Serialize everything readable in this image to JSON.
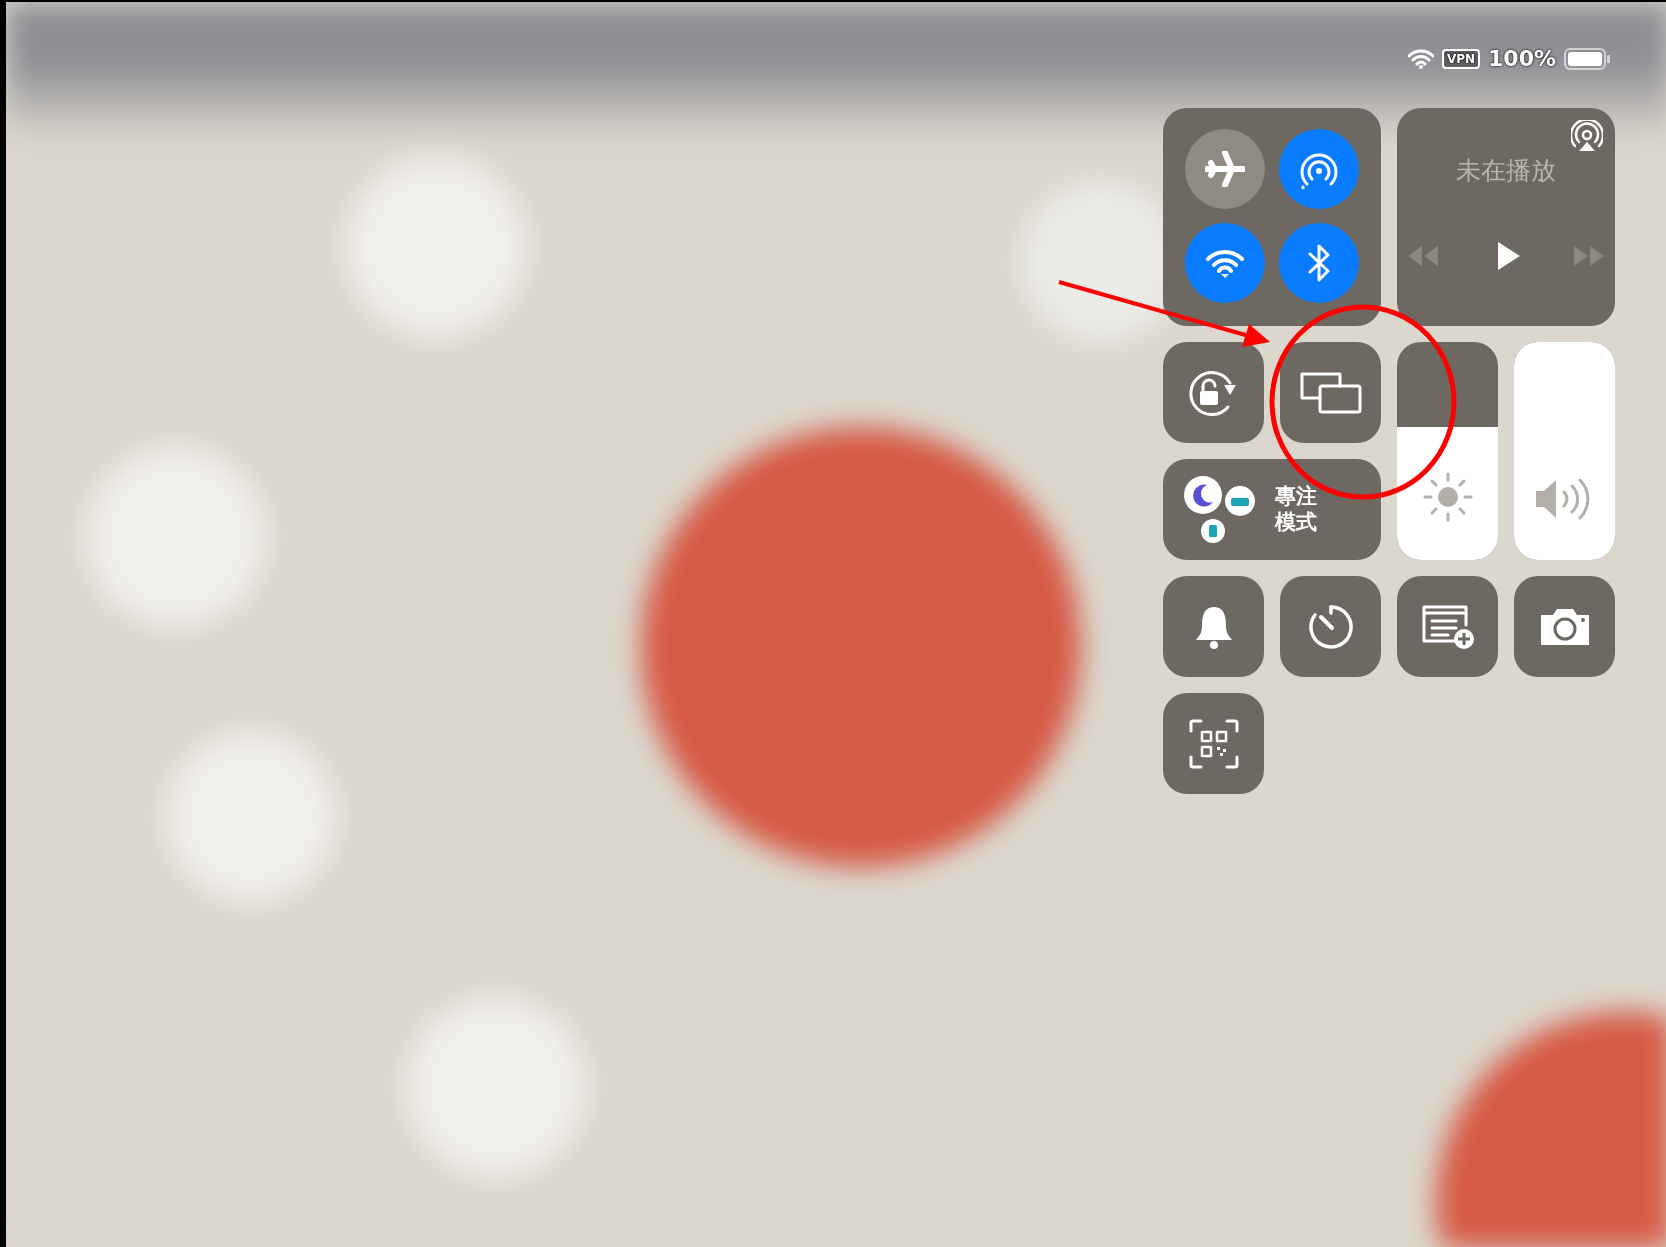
{
  "status_bar": {
    "vpn": "VPN",
    "battery": "100%"
  },
  "connectivity": [
    {
      "kind": "airplane",
      "on": false
    },
    {
      "kind": "airdrop",
      "on": true
    },
    {
      "kind": "wifi",
      "on": true
    },
    {
      "kind": "bluetooth",
      "on": true
    }
  ],
  "now_playing": {
    "title": "未在播放",
    "previous_enabled": false,
    "next_enabled": false
  },
  "toggles": [
    {
      "kind": "rotation-lock"
    },
    {
      "kind": "screen-mirroring"
    }
  ],
  "focus": {
    "label": "專注模式"
  },
  "sliders": [
    {
      "kind": "brightness",
      "level": 0.61
    },
    {
      "kind": "volume",
      "level": 1.0
    }
  ],
  "shortcuts": [
    {
      "kind": "bell"
    },
    {
      "kind": "timer"
    },
    {
      "kind": "quick-note"
    },
    {
      "kind": "camera"
    },
    {
      "kind": "qr-scanner"
    }
  ]
}
